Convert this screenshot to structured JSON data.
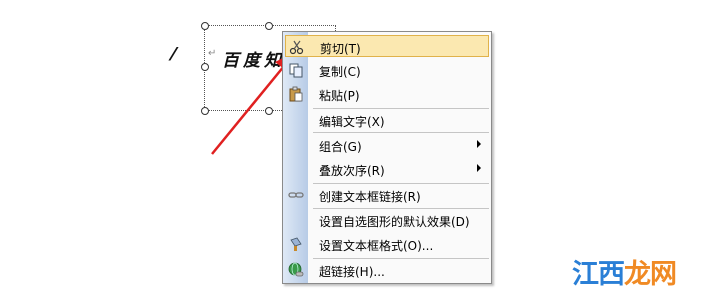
{
  "document": {
    "edge_fragment": "⁄",
    "paragraph_mark": "↵",
    "text": "百度知"
  },
  "context_menu": {
    "items": [
      {
        "label": "剪切(T)",
        "icon": "scissors-icon",
        "highlighted": true,
        "submenu": false
      },
      {
        "label": "复制(C)",
        "icon": "copy-icon",
        "highlighted": false,
        "submenu": false
      },
      {
        "label": "粘贴(P)",
        "icon": "paste-icon",
        "highlighted": false,
        "submenu": false
      },
      {
        "label": "编辑文字(X)",
        "icon": "",
        "highlighted": false,
        "submenu": false
      },
      {
        "label": "组合(G)",
        "icon": "",
        "highlighted": false,
        "submenu": true
      },
      {
        "label": "叠放次序(R)",
        "icon": "",
        "highlighted": false,
        "submenu": true
      },
      {
        "label": "创建文本框链接(R)",
        "icon": "chain-link-icon",
        "highlighted": false,
        "submenu": false
      },
      {
        "label": "设置自选图形的默认效果(D)",
        "icon": "",
        "highlighted": false,
        "submenu": false
      },
      {
        "label": "设置文本框格式(O)...",
        "icon": "format-brush-icon",
        "highlighted": false,
        "submenu": false
      },
      {
        "label": "超链接(H)...",
        "icon": "globe-link-icon",
        "highlighted": false,
        "submenu": false
      }
    ]
  },
  "colors": {
    "annotation_arrow": "#e02020",
    "menu_highlight": "#fbe8b0",
    "watermark_a": "#2a7fd6",
    "watermark_b": "#f08a24"
  },
  "watermark": {
    "part1": "江西",
    "part2": "龙网"
  }
}
